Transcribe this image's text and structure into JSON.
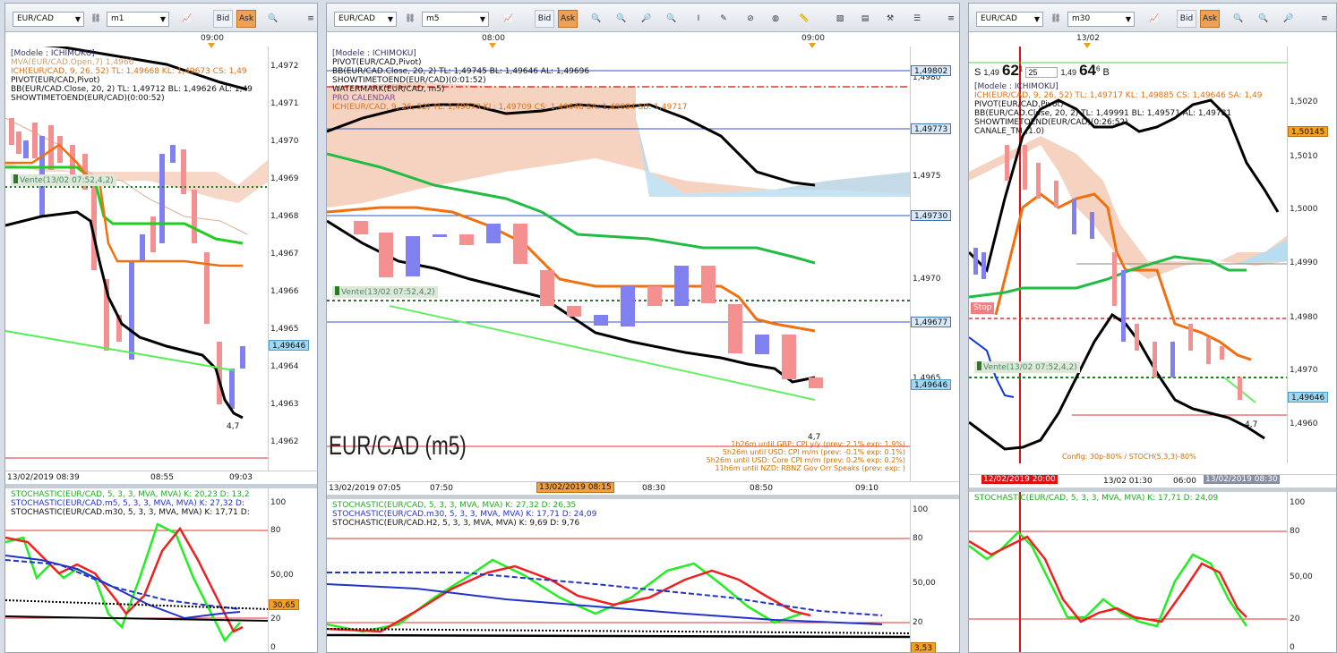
{
  "panes": [
    {
      "symbol": "EUR/CAD",
      "timeframe": "m1",
      "toolbar": {
        "bid_label": "Bid",
        "ask_label": "Ask"
      },
      "top_time": "09:00",
      "legend": [
        {
          "text": "[Modele : ICHIMOKU]",
          "color": "#333366"
        },
        {
          "text": "MVA(EUR/CAD.Open,7)  1,4966",
          "color": "#c8a070"
        },
        {
          "text": "ICH(EUR/CAD, 9, 26, 52)  TL: 1,49668  KL: 1,49673  CS: 1,49",
          "color": "#e07010"
        },
        {
          "text": "PIVOT(EUR/CAD,Pivot)",
          "color": "#111111"
        },
        {
          "text": "BB(EUR/CAD.Close, 20, 2)  TL: 1,49712  BL: 1,49626  AL: 1,49",
          "color": "#111111"
        },
        {
          "text": "SHOWTIMETOEND(EUR/CAD)(0:00:52)",
          "color": "#111111"
        }
      ],
      "price_labels": [
        "1,4972",
        "1,4971",
        "1,4970",
        "1,4969",
        "1,4968",
        "1,4967",
        "1,4966",
        "1,4965",
        "1,4964",
        "1,4963",
        "1,4962"
      ],
      "price_tags": [
        {
          "text": "1,49646",
          "style": "cyan"
        }
      ],
      "order_label": "Vente(13/02 07:52,4,2)",
      "arrow_value": "4,7",
      "x_labels": [
        "13/02/2019 08:39",
        "08:55",
        "09:03"
      ],
      "osc_legend": [
        {
          "text": "STOCHASTIC(EUR/CAD, 5, 3, 3, MVA, MVA)  K: 20,23  D: 13,2",
          "color": "#22aa22"
        },
        {
          "text": "STOCHASTIC(EUR/CAD.m5, 5, 3, 3, MVA, MVA)  K: 27,32  D:",
          "color": "#2233cc"
        },
        {
          "text": "STOCHASTIC(EUR/CAD.m30, 5, 3, 3, MVA, MVA)  K: 17,71  D:",
          "color": "#111111"
        }
      ],
      "osc_levels": [
        "100",
        "80",
        "50,00",
        "30,65",
        "20",
        "0"
      ]
    },
    {
      "symbol": "EUR/CAD",
      "timeframe": "m5",
      "toolbar": {
        "bid_label": "Bid",
        "ask_label": "Ask"
      },
      "top_times": [
        "08:00",
        "09:00"
      ],
      "legend": [
        {
          "text": "[Modele : ICHIMOKU]",
          "color": "#333366"
        },
        {
          "text": "PIVOT(EUR/CAD,Pivot)",
          "color": "#111111"
        },
        {
          "text": "BB(EUR/CAD.Close, 20, 2)  TL: 1,49745  BL: 1,49646  AL: 1,49696",
          "color": "#111111"
        },
        {
          "text": "SHOWTIMETOEND(EUR/CAD)(0:01:52)",
          "color": "#111111"
        },
        {
          "text": "WATERMARK(EUR/CAD, m5)",
          "color": "#111111"
        },
        {
          "text": "PRO CALENDAR",
          "color": "#7a4a9a"
        },
        {
          "text": "ICH(EUR/CAD, 9, 26, 52)  TL: 1,49673  KL: 1,49709  CS: 1,49646  SA: 1,49694  SB: 1,49717",
          "color": "#e07010"
        }
      ],
      "price_labels": [
        "1,4980",
        "1,4975",
        "1,4970",
        "1,4965"
      ],
      "price_tags": [
        {
          "text": "1,49802",
          "style": "blue"
        },
        {
          "text": "1,49773",
          "style": "blue"
        },
        {
          "text": "1,49730",
          "style": "blue"
        },
        {
          "text": "1,49677",
          "style": "blue"
        },
        {
          "text": "1,49646",
          "style": "cyan"
        }
      ],
      "order_label": "Vente(13/02 07:52,4,2)",
      "watermark": "EUR/CAD (m5)",
      "arrow_value": "4,7",
      "calendar": [
        "1h26m until GBP: CPI y/y (prev: 2.1% exp: 1.9%)",
        "5h26m until USD: CPI m/m (prev: -0.1% exp: 0.1%)",
        "5h26m until USD: Core CPI m/m (prev: 0.2% exp: 0.2%)",
        "11h6m until NZD: RBNZ Gov Orr Speaks (prev:  exp: )"
      ],
      "x_labels": [
        "13/02/2019 07:05",
        "07:50",
        "13/02/2019 08:15",
        "08:30",
        "08:50",
        "09:10"
      ],
      "osc_legend": [
        {
          "text": "STOCHASTIC(EUR/CAD, 5, 3, 3, MVA, MVA)  K: 27,32  D: 26,35",
          "color": "#22aa22"
        },
        {
          "text": "STOCHASTIC(EUR/CAD.m30, 5, 3, 3, MVA, MVA)  K: 17,71  D: 24,09",
          "color": "#2233cc"
        },
        {
          "text": "STOCHASTIC(EUR/CAD.H2, 5, 3, 3, MVA, MVA)  K: 9,69  D: 9,76",
          "color": "#111111"
        }
      ],
      "osc_levels": [
        "100",
        "80",
        "50,00",
        "20",
        "3,53"
      ]
    },
    {
      "symbol": "EUR/CAD",
      "timeframe": "m30",
      "toolbar": {
        "bid_label": "Bid",
        "ask_label": "Ask"
      },
      "top_time": "13/02",
      "quote": {
        "sell_label": "S",
        "sell_prefix": "1,49",
        "sell_big": "62",
        "sell_sup": "1",
        "qty": "25",
        "buy_prefix": "1,49",
        "buy_big": "64",
        "buy_sup": "6",
        "buy_label": "B"
      },
      "legend": [
        {
          "text": "[Modele : ICHIMOKU]",
          "color": "#333366"
        },
        {
          "text": "ICH(EUR/CAD, 9, 26, 52)  TL: 1,49717  KL: 1,49885  CS: 1,49646  SA: 1,49",
          "color": "#e07010"
        },
        {
          "text": "PIVOT(EUR/CAD,Pivot)",
          "color": "#111111"
        },
        {
          "text": "BB(EUR/CAD.Close, 20, 2)  TL: 1,49991  BL: 1,49571  AL: 1,49781",
          "color": "#111111"
        },
        {
          "text": "SHOWTIMETOEND(EUR/CAD)(0:26:52)",
          "color": "#111111"
        },
        {
          "text": "CANALE_TM (1.0)",
          "color": "#111111"
        }
      ],
      "price_labels": [
        "1,5020",
        "1,5010",
        "1,5000",
        "1,4990",
        "1,4980",
        "1,4970",
        "1,4960"
      ],
      "price_tags": [
        {
          "text": "1,50145",
          "style": "orange"
        },
        {
          "text": "1,49646",
          "style": "cyan"
        }
      ],
      "stop_label": "Stop",
      "order_label": "Vente(13/02 07:52,4,2)",
      "arrow_value": "4,7",
      "config_label": "Config: 30p-80% / STOCH(5,3,3)-80%",
      "x_labels": [
        "12/02/2019 20:00",
        "13/02 01:30",
        "06:00",
        "13/02/2019 08:30"
      ],
      "osc_legend": [
        {
          "text": "STOCHASTIC(EUR/CAD, 5, 3, 3, MVA, MVA)  K: 17,71  D: 24,09",
          "color": "#22aa22"
        }
      ],
      "osc_levels": [
        "100",
        "80",
        "50,00",
        "20",
        "0"
      ]
    }
  ]
}
